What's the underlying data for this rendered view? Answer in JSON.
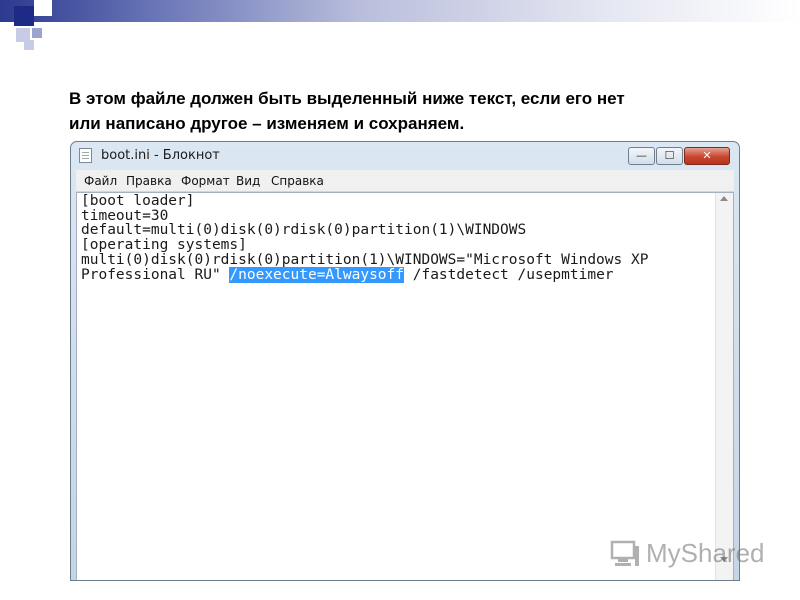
{
  "slide": {
    "instruction_line1": "В этом файле должен быть выделенный ниже текст, если его нет",
    "instruction_line2": "или написано другое – изменяем и сохраняем."
  },
  "window": {
    "title": "boot.ini - Блокнот",
    "controls": {
      "minimize": "—",
      "maximize": "☐",
      "close": "✕"
    }
  },
  "menu": [
    "Файл",
    "Правка",
    "Формат",
    "Вид",
    "Справка"
  ],
  "editor": {
    "lines": [
      "[boot loader]",
      "timeout=30",
      "default=multi(0)disk(0)rdisk(0)partition(1)\\WINDOWS",
      "[operating systems]",
      "multi(0)disk(0)rdisk(0)partition(1)\\WINDOWS=\"Microsoft Windows XP"
    ],
    "line6_before": "Professional RU\" ",
    "line6_selected": "/noexecute=Alwaysoff",
    "line6_after": " /fastdetect /usepmtimer",
    "selection_color": "#3399ff"
  },
  "watermark": {
    "text": "MyShared"
  },
  "colors": {
    "accent": "#1d2a86",
    "close_button": "#c7462f"
  }
}
